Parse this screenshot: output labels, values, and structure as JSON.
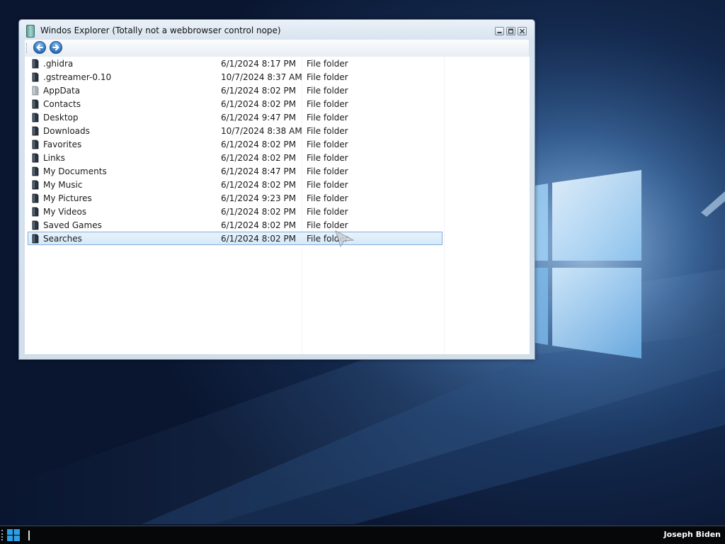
{
  "window": {
    "title": "Windos Explorer (Totally not a webbrowser control nope)",
    "controls": [
      "minimize",
      "maximize",
      "close"
    ]
  },
  "toolbar": {
    "back_icon": "back-arrow-icon",
    "forward_icon": "forward-arrow-icon"
  },
  "files": [
    {
      "name": ".ghidra",
      "modified": "6/1/2024 8:17 PM",
      "type": "File folder"
    },
    {
      "name": ".gstreamer-0.10",
      "modified": "10/7/2024 8:37 AM",
      "type": "File folder"
    },
    {
      "name": "AppData",
      "modified": "6/1/2024 8:02 PM",
      "type": "File folder"
    },
    {
      "name": "Contacts",
      "modified": "6/1/2024 8:02 PM",
      "type": "File folder"
    },
    {
      "name": "Desktop",
      "modified": "6/1/2024 9:47 PM",
      "type": "File folder"
    },
    {
      "name": "Downloads",
      "modified": "10/7/2024 8:38 AM",
      "type": "File folder"
    },
    {
      "name": "Favorites",
      "modified": "6/1/2024 8:02 PM",
      "type": "File folder"
    },
    {
      "name": "Links",
      "modified": "6/1/2024 8:02 PM",
      "type": "File folder"
    },
    {
      "name": "My Documents",
      "modified": "6/1/2024 8:47 PM",
      "type": "File folder"
    },
    {
      "name": "My Music",
      "modified": "6/1/2024 8:02 PM",
      "type": "File folder"
    },
    {
      "name": "My Pictures",
      "modified": "6/1/2024 9:23 PM",
      "type": "File folder"
    },
    {
      "name": "My Videos",
      "modified": "6/1/2024 8:02 PM",
      "type": "File folder"
    },
    {
      "name": "Saved Games",
      "modified": "6/1/2024 8:02 PM",
      "type": "File folder"
    },
    {
      "name": "Searches",
      "modified": "6/1/2024 8:02 PM",
      "type": "File folder"
    }
  ],
  "selected_index": 13,
  "taskbar": {
    "start_icon": "windows-logo-icon",
    "user_name": "Joseph Biden"
  },
  "colors": {
    "selection_fill": "#d9ecfa",
    "selection_border": "#84acdd",
    "taskbar": "#050709",
    "window_frame": "#d2deea"
  }
}
